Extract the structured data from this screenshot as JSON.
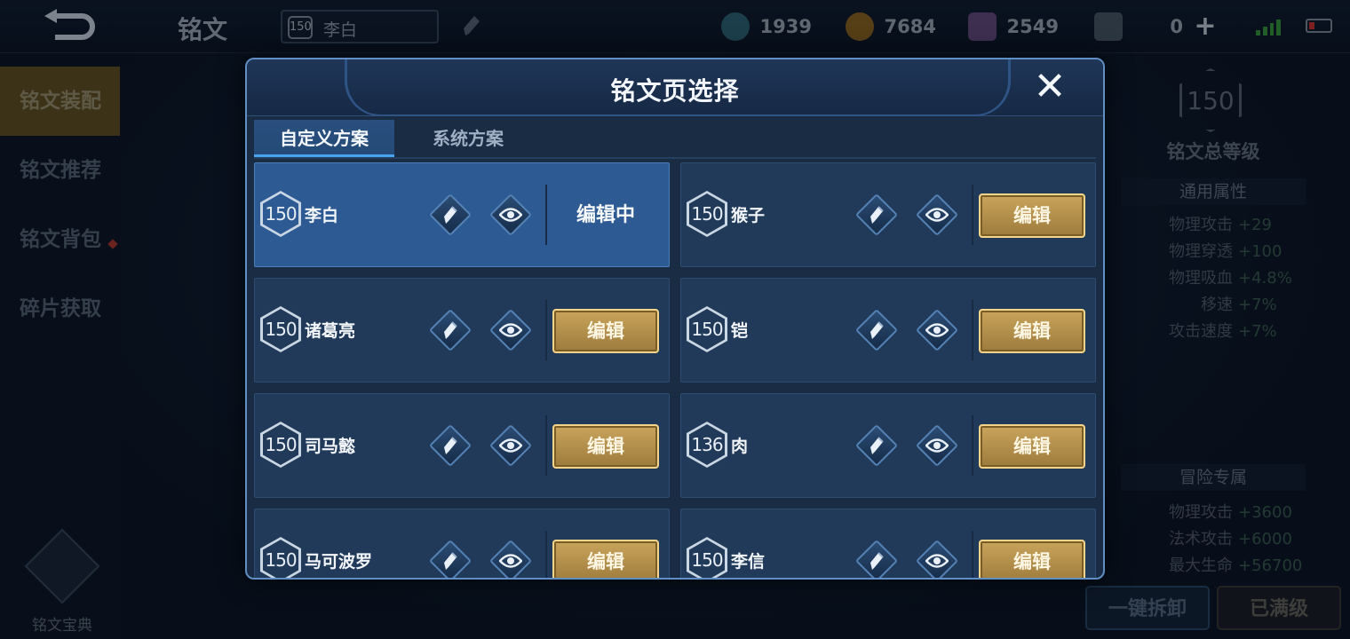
{
  "topbar": {
    "title": "铭文",
    "hero": {
      "level": "150",
      "name": "李白"
    },
    "resources": [
      {
        "icon": "gem-icon",
        "value": "1939",
        "color": "#3a7f8f"
      },
      {
        "icon": "gold-coin-icon",
        "value": "7684",
        "color": "#b07a22"
      },
      {
        "icon": "crystal-icon",
        "value": "2549",
        "color": "#7d5a9a"
      },
      {
        "icon": "card-icon",
        "value": "0",
        "color": "#5a6878"
      }
    ]
  },
  "sidebar": {
    "items": [
      {
        "label": "铭文装配"
      },
      {
        "label": "铭文推荐"
      },
      {
        "label": "铭文背包"
      },
      {
        "label": "碎片获取"
      }
    ],
    "codex_label": "铭文宝典"
  },
  "right_panel": {
    "level": "150",
    "title": "铭文总等级",
    "general_header": "通用属性",
    "general": [
      {
        "k": "物理攻击",
        "v": "+29"
      },
      {
        "k": "物理穿透",
        "v": "+100"
      },
      {
        "k": "物理吸血",
        "v": "+4.8%"
      },
      {
        "k": "移速",
        "v": "+7%"
      },
      {
        "k": "攻击速度",
        "v": "+7%"
      }
    ],
    "adventure_header": "冒险专属",
    "adventure": [
      {
        "k": "物理攻击",
        "v": "+3600"
      },
      {
        "k": "法术攻击",
        "v": "+6000"
      },
      {
        "k": "最大生命",
        "v": "+56700"
      }
    ],
    "unload_label": "一键拆卸",
    "max_label": "已满级"
  },
  "modal": {
    "title": "铭文页选择",
    "tabs": [
      {
        "label": "自定义方案"
      },
      {
        "label": "系统方案"
      }
    ],
    "editing_label": "编辑中",
    "edit_label": "编辑",
    "plans": [
      {
        "level": "150",
        "name": "李白"
      },
      {
        "level": "150",
        "name": "猴子"
      },
      {
        "level": "150",
        "name": "诸葛亮"
      },
      {
        "level": "150",
        "name": "铠"
      },
      {
        "level": "150",
        "name": "司马懿"
      },
      {
        "level": "136",
        "name": "肉"
      },
      {
        "level": "150",
        "name": "马可波罗"
      },
      {
        "level": "150",
        "name": "李信"
      }
    ]
  }
}
